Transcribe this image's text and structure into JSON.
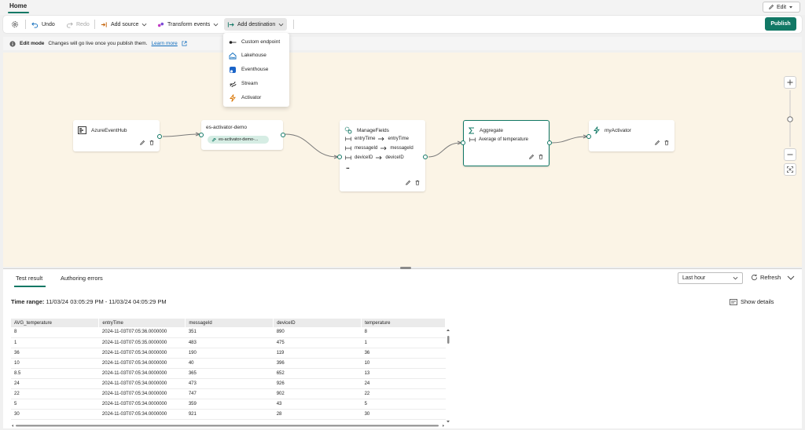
{
  "header": {
    "tab_home": "Home",
    "edit_label": "Edit"
  },
  "toolbar": {
    "undo": "Undo",
    "redo": "Redo",
    "add_source": "Add source",
    "transform_events": "Transform events",
    "add_destination": "Add destination",
    "publish": "Publish"
  },
  "infobar": {
    "mode": "Edit mode",
    "message": "Changes will go live once you publish them.",
    "link": "Learn more"
  },
  "destination_menu": {
    "items": [
      {
        "label": "Custom endpoint",
        "icon": "custom-endpoint-icon"
      },
      {
        "label": "Lakehouse",
        "icon": "lakehouse-icon"
      },
      {
        "label": "Eventhouse",
        "icon": "eventhouse-icon"
      },
      {
        "label": "Stream",
        "icon": "stream-icon"
      },
      {
        "label": "Activator",
        "icon": "activator-icon"
      }
    ]
  },
  "nodes": {
    "source": {
      "title": "AzureEventHub"
    },
    "stream": {
      "title": "es-activator-demo",
      "chip": "es-activator-demo-..."
    },
    "manage": {
      "title": "ManageFields",
      "mappings": [
        {
          "from": "entryTime",
          "to": "entryTime"
        },
        {
          "from": "messageId",
          "to": "messageId"
        },
        {
          "from": "deviceID",
          "to": "deviceID"
        }
      ],
      "more": "..."
    },
    "aggregate": {
      "title": "Aggregate",
      "detail": "Average of temperature"
    },
    "activator": {
      "title": "myActivator"
    }
  },
  "results": {
    "tabs": [
      "Test result",
      "Authoring errors"
    ],
    "time_select": "Last hour",
    "refresh": "Refresh",
    "time_range_label": "Time range:",
    "time_range_value": "11/03/24 03:05:29 PM - 11/03/24 04:05:29 PM",
    "show_details": "Show details",
    "columns": [
      "AVG_temperature",
      "entryTime",
      "messageId",
      "deviceID",
      "temperature"
    ],
    "rows": [
      [
        "8",
        "2024-11-03T07:05:36.0000000",
        "351",
        "890",
        "8"
      ],
      [
        "1",
        "2024-11-03T07:05:35.0000000",
        "483",
        "475",
        "1"
      ],
      [
        "36",
        "2024-11-03T07:05:34.0000000",
        "190",
        "119",
        "36"
      ],
      [
        "10",
        "2024-11-03T07:05:34.0000000",
        "40",
        "396",
        "10"
      ],
      [
        "8.5",
        "2024-11-03T07:05:34.0000000",
        "365",
        "652",
        "13"
      ],
      [
        "24",
        "2024-11-03T07:05:34.0000000",
        "473",
        "926",
        "24"
      ],
      [
        "22",
        "2024-11-03T07:05:34.0000000",
        "747",
        "902",
        "22"
      ],
      [
        "5",
        "2024-11-03T07:05:34.0000000",
        "359",
        "43",
        "5"
      ],
      [
        "30",
        "2024-11-03T07:05:34.0000000",
        "921",
        "28",
        "30"
      ]
    ]
  },
  "colors": {
    "accent": "#117865",
    "canvas": "#fbf4e6",
    "link": "#0f6cbd"
  }
}
